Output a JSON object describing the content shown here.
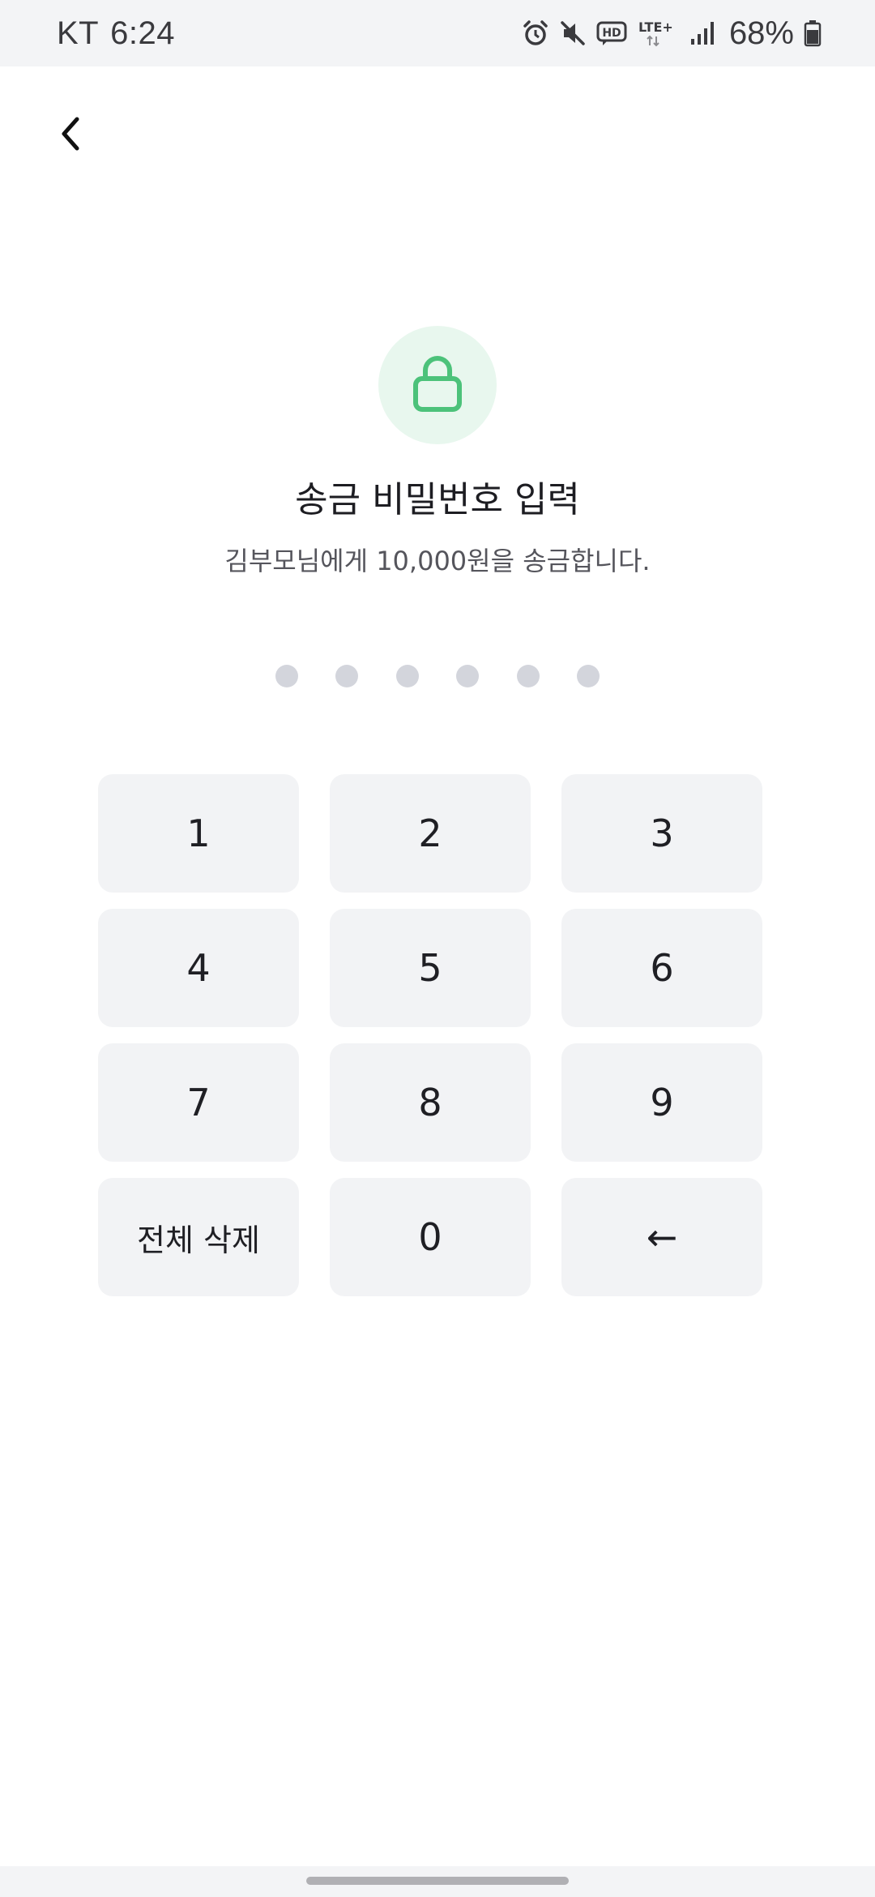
{
  "status_bar": {
    "carrier": "KT",
    "time": "6:24",
    "network": "LTE+",
    "battery": "68%",
    "icons": [
      "alarm-icon",
      "mute-icon",
      "hd-voice-icon",
      "lte-plus-icon",
      "signal-icon",
      "battery-icon"
    ]
  },
  "header": {
    "back_icon": "chevron-left-icon"
  },
  "main": {
    "icon": "lock-icon",
    "accent_color": "#4cc27a",
    "badge_color": "#e8f7ee",
    "title": "송금 비밀번호 입력",
    "subtitle": "김부모님에게 10,000원을 송금합니다.",
    "pin_length": 6,
    "pin_filled": 0
  },
  "keypad": {
    "keys": [
      "1",
      "2",
      "3",
      "4",
      "5",
      "6",
      "7",
      "8",
      "9",
      "전체 삭제",
      "0",
      "←"
    ]
  }
}
